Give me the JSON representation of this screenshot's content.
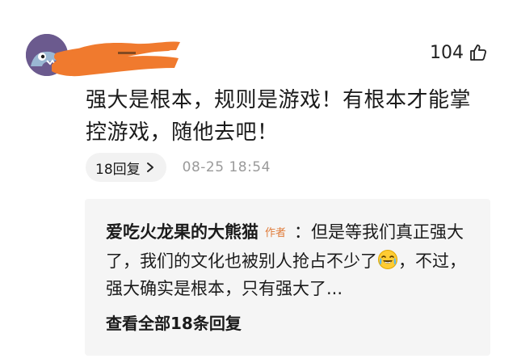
{
  "comment": {
    "like_count": "104",
    "text": "强大是根本，规则是游戏！有根本才能掌控游戏，随他去吧！",
    "reply_count_label": "18回复",
    "timestamp": "08-25 18:54"
  },
  "reply": {
    "author": "爱吃火龙果的大熊猫",
    "author_tag": "作者",
    "text_before_emoji": "：但是等我们真正强大了，我们的文化也被别人抢占不少了",
    "text_after_emoji": "，不过，强大确实是根本，只有强大了...",
    "emoji": "crying-laughing-emoji",
    "view_all_label": "查看全部18条回复"
  },
  "colors": {
    "redaction": "#f07a2e",
    "author_tag": "#e07b39",
    "reply_background": "#f5f5f5",
    "avatar_background": "#6b5a8e"
  },
  "icons": [
    "thumbs-up-icon",
    "chevron-right-icon",
    "crying-laughing-emoji"
  ]
}
